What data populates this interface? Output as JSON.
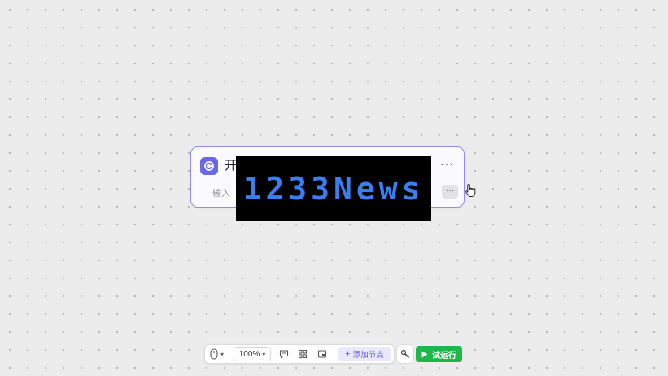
{
  "node": {
    "title": "开",
    "more_label": "···",
    "input_label": "输入",
    "edit_label": "···",
    "icon": "start-icon",
    "accent_color": "#6a67e8",
    "border_color": "#8f8cf0"
  },
  "watermark": {
    "text": "1233News",
    "color": "#3a7ef0"
  },
  "toolbar": {
    "pointer_icon": "mouse-icon",
    "zoom_value": "100%",
    "comment_icon": "comment-icon",
    "layout_icon": "grid-icon",
    "minimap_icon": "minimap-icon",
    "add_node_label": "添加节点",
    "tools_icon": "wrench-icon",
    "run_label": "试运行",
    "run_color": "#1fb64c"
  }
}
